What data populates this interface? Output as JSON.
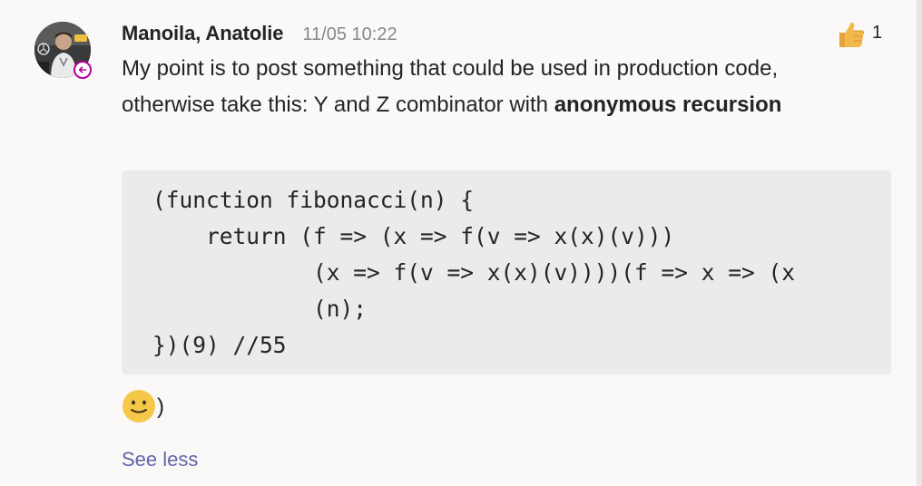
{
  "message": {
    "author": "Manoila, Anatolie",
    "timestamp": "11/05 10:22",
    "reaction": {
      "icon": "thumbs-up-icon",
      "count": "1"
    },
    "presence": {
      "icon": "out-of-office-arrow-icon",
      "color": "#b4009e"
    },
    "body": {
      "line1": "My point is to post something that could be used in production code,",
      "line2_prefix": "otherwise take this: Y and Z combinator with ",
      "line2_bold": "anonymous recursion"
    },
    "code": [
      "(function fibonacci(n) {",
      "    return (f => (x => f(v => x(x)(v)))",
      "            (x => f(v => x(x)(v))))(f => x => (x",
      "            (n);",
      "})(9) //55"
    ],
    "emoji_suffix": ")",
    "emoji_icon": "smiley-emoji-icon",
    "see_less": "See less"
  },
  "colors": {
    "accent": "#6264a7",
    "timestamp": "#8a8886",
    "code_background": "#edebe9",
    "card_background": "#faf9f8"
  }
}
